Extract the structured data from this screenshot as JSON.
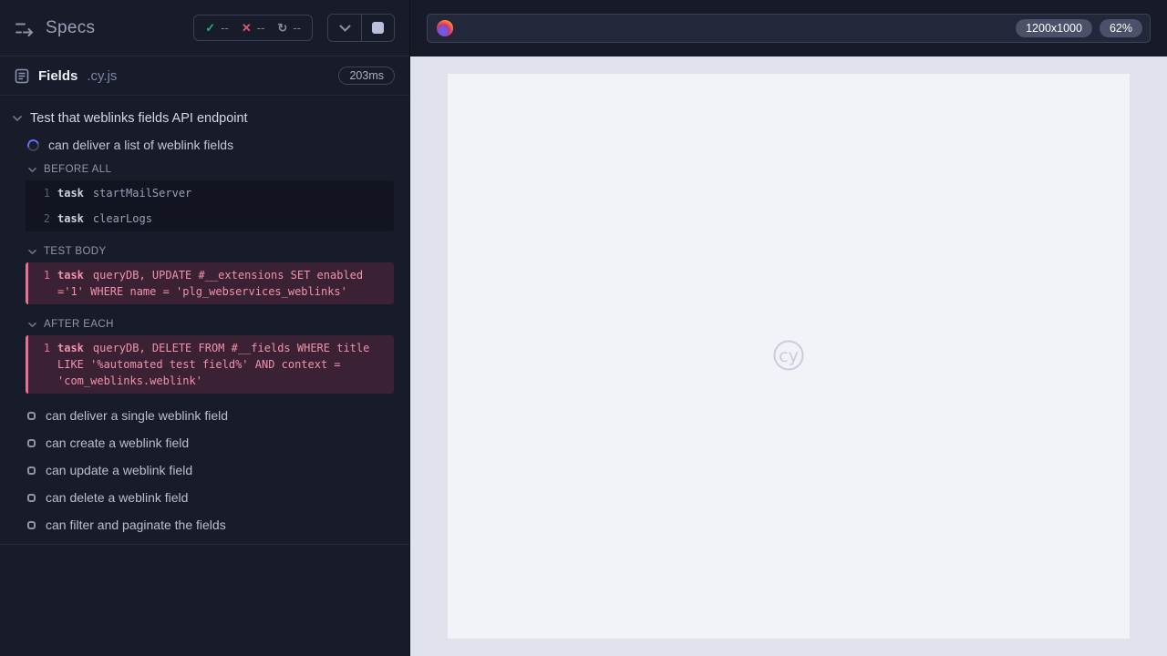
{
  "sidebar": {
    "title": "Specs",
    "stats": {
      "passed": "--",
      "failed": "--",
      "running": "--"
    },
    "spec": {
      "name": "Fields",
      "extension": ".cy.js",
      "duration": "203ms"
    },
    "suite": {
      "title": "Test that weblinks fields API endpoint",
      "active_test": "can deliver a list of weblink fields",
      "hooks": {
        "before_all": {
          "label": "BEFORE ALL",
          "commands": [
            {
              "line": "1",
              "method": "task",
              "message": "startMailServer"
            },
            {
              "line": "2",
              "method": "task",
              "message": "clearLogs"
            }
          ]
        },
        "test_body": {
          "label": "TEST BODY",
          "command": {
            "line": "1",
            "method": "task",
            "message": "queryDB, UPDATE #__extensions SET enabled ='1' WHERE name = 'plg_webservices_weblinks'"
          }
        },
        "after_each": {
          "label": "AFTER EACH",
          "command": {
            "line": "1",
            "method": "task",
            "message": "queryDB, DELETE FROM #__fields WHERE title LIKE '%automated test field%' AND context = 'com_weblinks.weblink'"
          }
        }
      },
      "pending_tests": [
        "can deliver a single weblink field",
        "can create a weblink field",
        "can update a weblink field",
        "can delete a weblink field",
        "can filter and paginate the fields"
      ]
    }
  },
  "browser": {
    "viewport_size": "1200x1000",
    "zoom_level": "62%",
    "logo_text": "cy"
  },
  "colors": {
    "sidebar_bg": "#181b2a",
    "code_bg": "#121521",
    "highlight_bg": "#3a2133",
    "highlight_border": "#e8718f",
    "highlight_text": "#f192ac",
    "accent_running": "#6470f5",
    "pass_green": "#22b074",
    "fail_red": "#e1566c",
    "stage_bg": "#e1e3ec",
    "viewport_bg": "#f2f3f8"
  }
}
